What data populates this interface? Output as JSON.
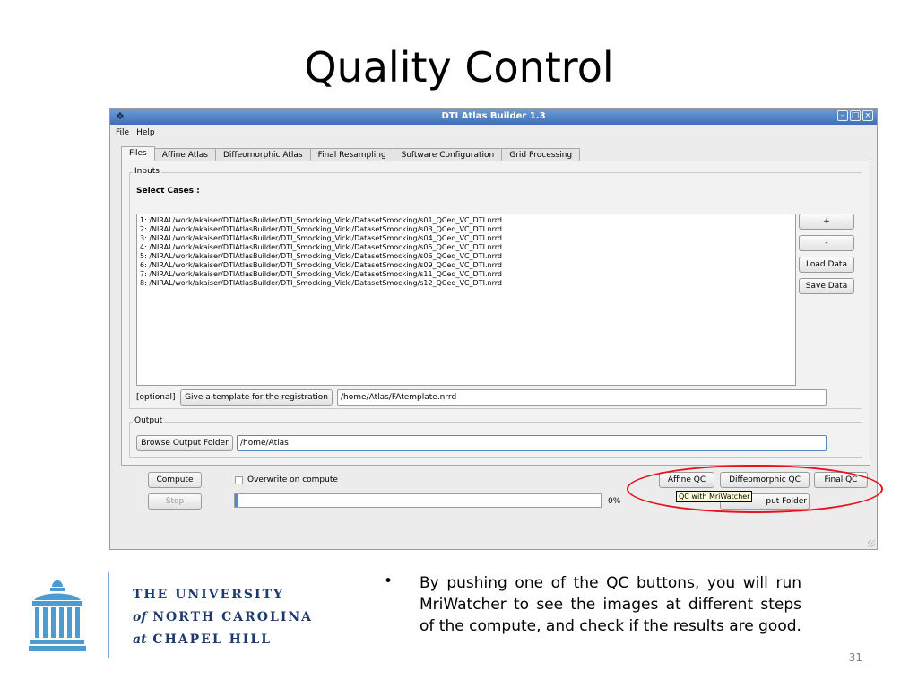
{
  "slide": {
    "title": "Quality Control",
    "bullet": "By pushing one of the QC buttons, you will run MriWatcher to see the images at different steps of the compute, and check if the results are good.",
    "page_number": "31"
  },
  "logo": {
    "line1": "THE UNIVERSITY",
    "line2_prefix": "of",
    "line2_rest": "NORTH CAROLINA",
    "line3_prefix": "at",
    "line3_rest": "CHAPEL HILL"
  },
  "window": {
    "title": "DTI Atlas Builder 1.3",
    "menu": [
      "File",
      "Help"
    ],
    "tabs": [
      "Files",
      "Affine Atlas",
      "Diffeomorphic Atlas",
      "Final Resampling",
      "Software Configuration",
      "Grid Processing"
    ],
    "inputs_group": "Inputs",
    "select_cases": "Select Cases :",
    "cases": [
      "1: /NIRAL/work/akaiser/DTIAtlasBuilder/DTI_Smocking_Vicki/DatasetSmocking/s01_QCed_VC_DTI.nrrd",
      "2: /NIRAL/work/akaiser/DTIAtlasBuilder/DTI_Smocking_Vicki/DatasetSmocking/s03_QCed_VC_DTI.nrrd",
      "3: /NIRAL/work/akaiser/DTIAtlasBuilder/DTI_Smocking_Vicki/DatasetSmocking/s04_QCed_VC_DTI.nrrd",
      "4: /NIRAL/work/akaiser/DTIAtlasBuilder/DTI_Smocking_Vicki/DatasetSmocking/s05_QCed_VC_DTI.nrrd",
      "5: /NIRAL/work/akaiser/DTIAtlasBuilder/DTI_Smocking_Vicki/DatasetSmocking/s06_QCed_VC_DTI.nrrd",
      "6: /NIRAL/work/akaiser/DTIAtlasBuilder/DTI_Smocking_Vicki/DatasetSmocking/s09_QCed_VC_DTI.nrrd",
      "7: /NIRAL/work/akaiser/DTIAtlasBuilder/DTI_Smocking_Vicki/DatasetSmocking/s11_QCed_VC_DTI.nrrd",
      "8: /NIRAL/work/akaiser/DTIAtlasBuilder/DTI_Smocking_Vicki/DatasetSmocking/s12_QCed_VC_DTI.nrrd"
    ],
    "side_buttons": {
      "add": "+",
      "remove": "-",
      "load": "Load Data",
      "save": "Save Data"
    },
    "optional_label": "[optional]",
    "template_button": "Give a template for the registration",
    "template_value": "/home/Atlas/FAtemplate.nrrd",
    "output_group": "Output",
    "browse_output_button": "Browse Output Folder",
    "output_value": "/home/Atlas",
    "compute_button": "Compute",
    "stop_button": "Stop",
    "overwrite_label": "Overwrite on compute",
    "progress_text": "0%",
    "progress_value": 0.01,
    "qc_buttons": {
      "affine": "Affine QC",
      "diffeo": "Diffeomorphic QC",
      "final": "Final QC"
    },
    "open_output_button_partial": "put Folder",
    "tooltip": "QC with MriWatcher"
  },
  "colors": {
    "highlight": "#e8121b",
    "unc_navy": "#1c3a6b",
    "unc_blue": "#4b9cd3"
  }
}
